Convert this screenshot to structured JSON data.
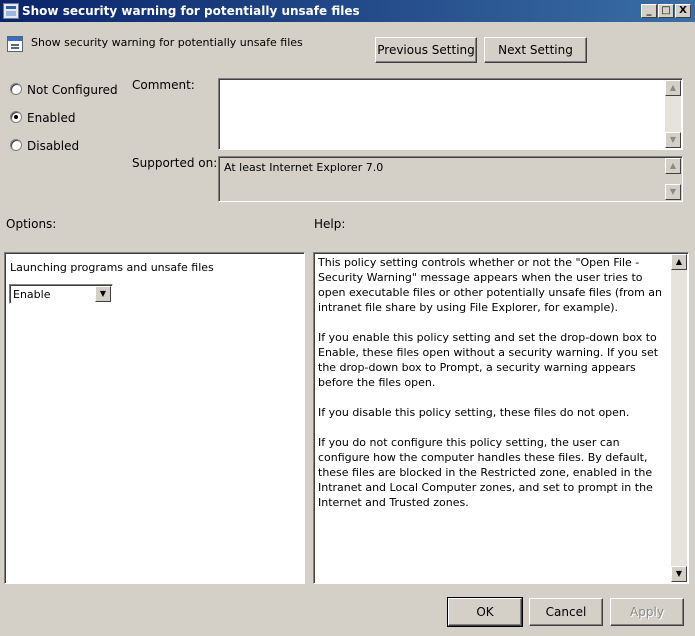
{
  "window": {
    "title": "Show security warning for potentially unsafe files",
    "minimize": "_",
    "maximize": "□",
    "close": "X"
  },
  "header": {
    "policy_name": "Show security warning for potentially unsafe files",
    "prev_button": "Previous Setting",
    "next_button": "Next Setting"
  },
  "state": {
    "options": [
      {
        "label": "Not Configured",
        "checked": false
      },
      {
        "label": "Enabled",
        "checked": true
      },
      {
        "label": "Disabled",
        "checked": false
      }
    ]
  },
  "comment": {
    "label": "Comment:",
    "value": ""
  },
  "supported": {
    "label": "Supported on:",
    "value": "At least Internet Explorer 7.0"
  },
  "options_panel": {
    "label": "Options:",
    "field_label": "Launching programs and unsafe files",
    "select_value": "Enable"
  },
  "help_panel": {
    "label": "Help:",
    "paragraphs": [
      "This policy setting controls whether or not the \"Open File - Security Warning\" message appears when the user tries to open executable files or other potentially unsafe files (from an intranet file share by using File Explorer, for example).",
      "If you enable this policy setting and set the drop-down box to Enable, these files open without a security warning. If you set the drop-down box to Prompt, a security warning appears before the files open.",
      "If you disable this policy setting, these files do not open.",
      "If you do not configure this policy setting, the user can configure how the computer handles these files. By default, these files are blocked in the Restricted zone, enabled in the Intranet and Local Computer zones, and set to prompt in the Internet and Trusted zones."
    ]
  },
  "footer": {
    "ok": "OK",
    "cancel": "Cancel",
    "apply": "Apply"
  },
  "icons": {
    "scroll_up": "scroll-up-arrow-icon",
    "scroll_down": "scroll-down-arrow-icon",
    "dropdown": "dropdown-arrow-icon"
  }
}
